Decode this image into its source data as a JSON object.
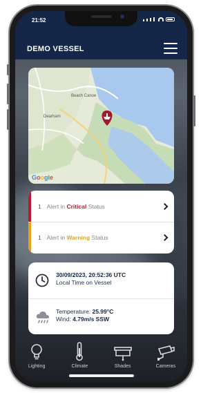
{
  "status_bar": {
    "time": "21:52"
  },
  "header": {
    "title": "DEMO VESSEL",
    "menu_icon": "hamburger-menu-icon"
  },
  "map": {
    "places": [
      "Dearham",
      "Beach Canoe"
    ],
    "attribution": "Google",
    "marker_icon": "vessel-location-pin-icon"
  },
  "alerts": [
    {
      "count": "1",
      "prefix": "Alert in",
      "level": "Critical",
      "suffix": "Status",
      "color": "#b81c2c"
    },
    {
      "count": "1",
      "prefix": "Alert in",
      "level": "Warning",
      "suffix": "Status",
      "color": "#e3a21b"
    }
  ],
  "info": {
    "datetime": "30/09/2023, 20:52:36 UTC",
    "time_caption": "Local Time on Vessel",
    "temperature_label": "Temperature:",
    "temperature_value": "25.99°C",
    "wind_label": "Wind:",
    "wind_value": "4.79m/s SSW"
  },
  "nav": [
    {
      "label": "Lighting",
      "icon": "lightbulb-icon"
    },
    {
      "label": "Climate",
      "icon": "thermometer-icon"
    },
    {
      "label": "Shades",
      "icon": "shades-icon"
    },
    {
      "label": "Cameras",
      "icon": "camera-icon"
    }
  ],
  "colors": {
    "header_bg": "#142748",
    "critical": "#b81c2c",
    "warning": "#e3a21b",
    "text_dark": "#142748"
  }
}
